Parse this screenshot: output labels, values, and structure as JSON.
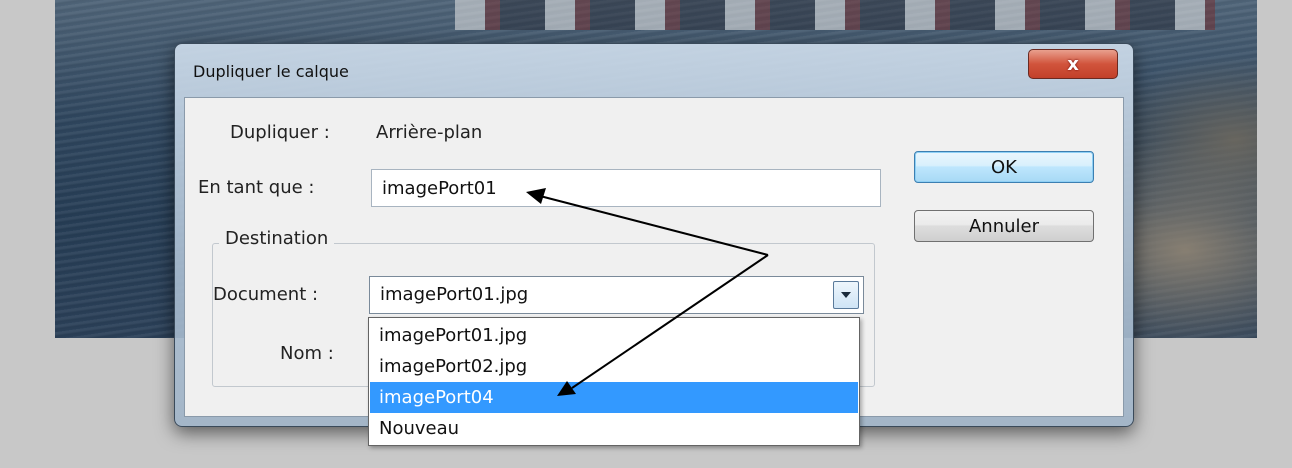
{
  "dialog": {
    "title": "Dupliquer le calque",
    "close_label": "x"
  },
  "form": {
    "duplicate_label": "Dupliquer :",
    "duplicate_value": "Arrière-plan",
    "as_label": "En tant que :",
    "as_value": "imagePort01",
    "destination_legend": "Destination",
    "document_label": "Document :",
    "document_selected": "imagePort01.jpg",
    "name_label": "Nom :"
  },
  "buttons": {
    "ok_label": "OK",
    "cancel_label": "Annuler"
  },
  "document_options": [
    "imagePort01.jpg",
    "imagePort02.jpg",
    "imagePort04",
    "Nouveau"
  ],
  "selected_option_index": 2
}
